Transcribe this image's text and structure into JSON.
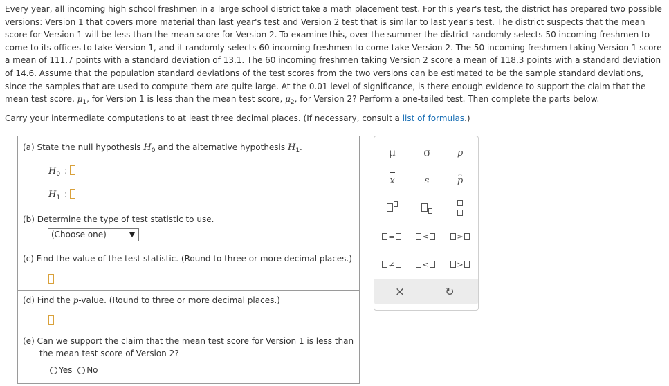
{
  "problem": {
    "p1": "Every year, all incoming high school freshmen in a large school district take a math placement test. For this year's test, the district has prepared two possible versions: Version 1 that covers more material than last year's test and Version 2 test that is similar to last year's test. The district suspects that the mean score for Version 1 will be less than the mean score for Version 2. To examine this, over the summer the district randomly selects 50 incoming freshmen to come to its offices to take Version 1, and it randomly selects 60 incoming freshmen to come take Version 2. The 50 incoming freshmen taking Version 1 score a mean of 111.7 points with a standard deviation of 13.1. The 60 incoming freshmen taking Version 2 score a mean of 118.3 points with a standard deviation of 14.6. Assume that the population standard deviations of the test scores from the two versions can be estimated to be the sample standard deviations, since the samples that are used to compute them are quite large. At the 0.01 level of significance, is there enough evidence to support the claim that the mean test score,",
    "mu1": "μ",
    "mu1_sub": "1",
    "p2": ", for Version 1 is less than the mean test score,",
    "mu2": "μ",
    "mu2_sub": "2",
    "p3": ", for Version 2? Perform a one-tailed test. Then complete the parts below."
  },
  "carry": {
    "text": "Carry your intermediate computations to at least three decimal places. (If necessary, consult a",
    "link": "list of formulas",
    "end": ".)"
  },
  "part_a": {
    "label": "(a) State the null hypothesis",
    "h0": "H",
    "h0_sub": "0",
    "and": "and the alternative hypothesis",
    "h1": "H",
    "h1_sub": "1",
    "period": ".",
    "colon": ":"
  },
  "part_b": {
    "label": "(b) Determine the type of test statistic to use.",
    "select_value": "(Choose one)"
  },
  "part_c": {
    "label": "(c) Find the value of the test statistic. (Round to three or more decimal places.)"
  },
  "part_d": {
    "label_pre": "(d) Find the ",
    "p": "p",
    "label_post": "-value. (Round to three or more decimal places.)"
  },
  "part_e": {
    "line1": "(e) Can we support the claim that the mean test score for Version 1 is less than",
    "line2": "the mean test score of Version 2?",
    "yes": "Yes",
    "no": "No"
  },
  "palette": {
    "mu": "μ",
    "sigma": "σ",
    "p": "p",
    "xbar": "x",
    "s": "s",
    "phat": "p",
    "hat": "^",
    "eq": "=",
    "le": "≤",
    "ge": "≥",
    "ne": "≠",
    "lt": "<",
    "gt": ">",
    "clear": "×",
    "undo": "↻"
  }
}
